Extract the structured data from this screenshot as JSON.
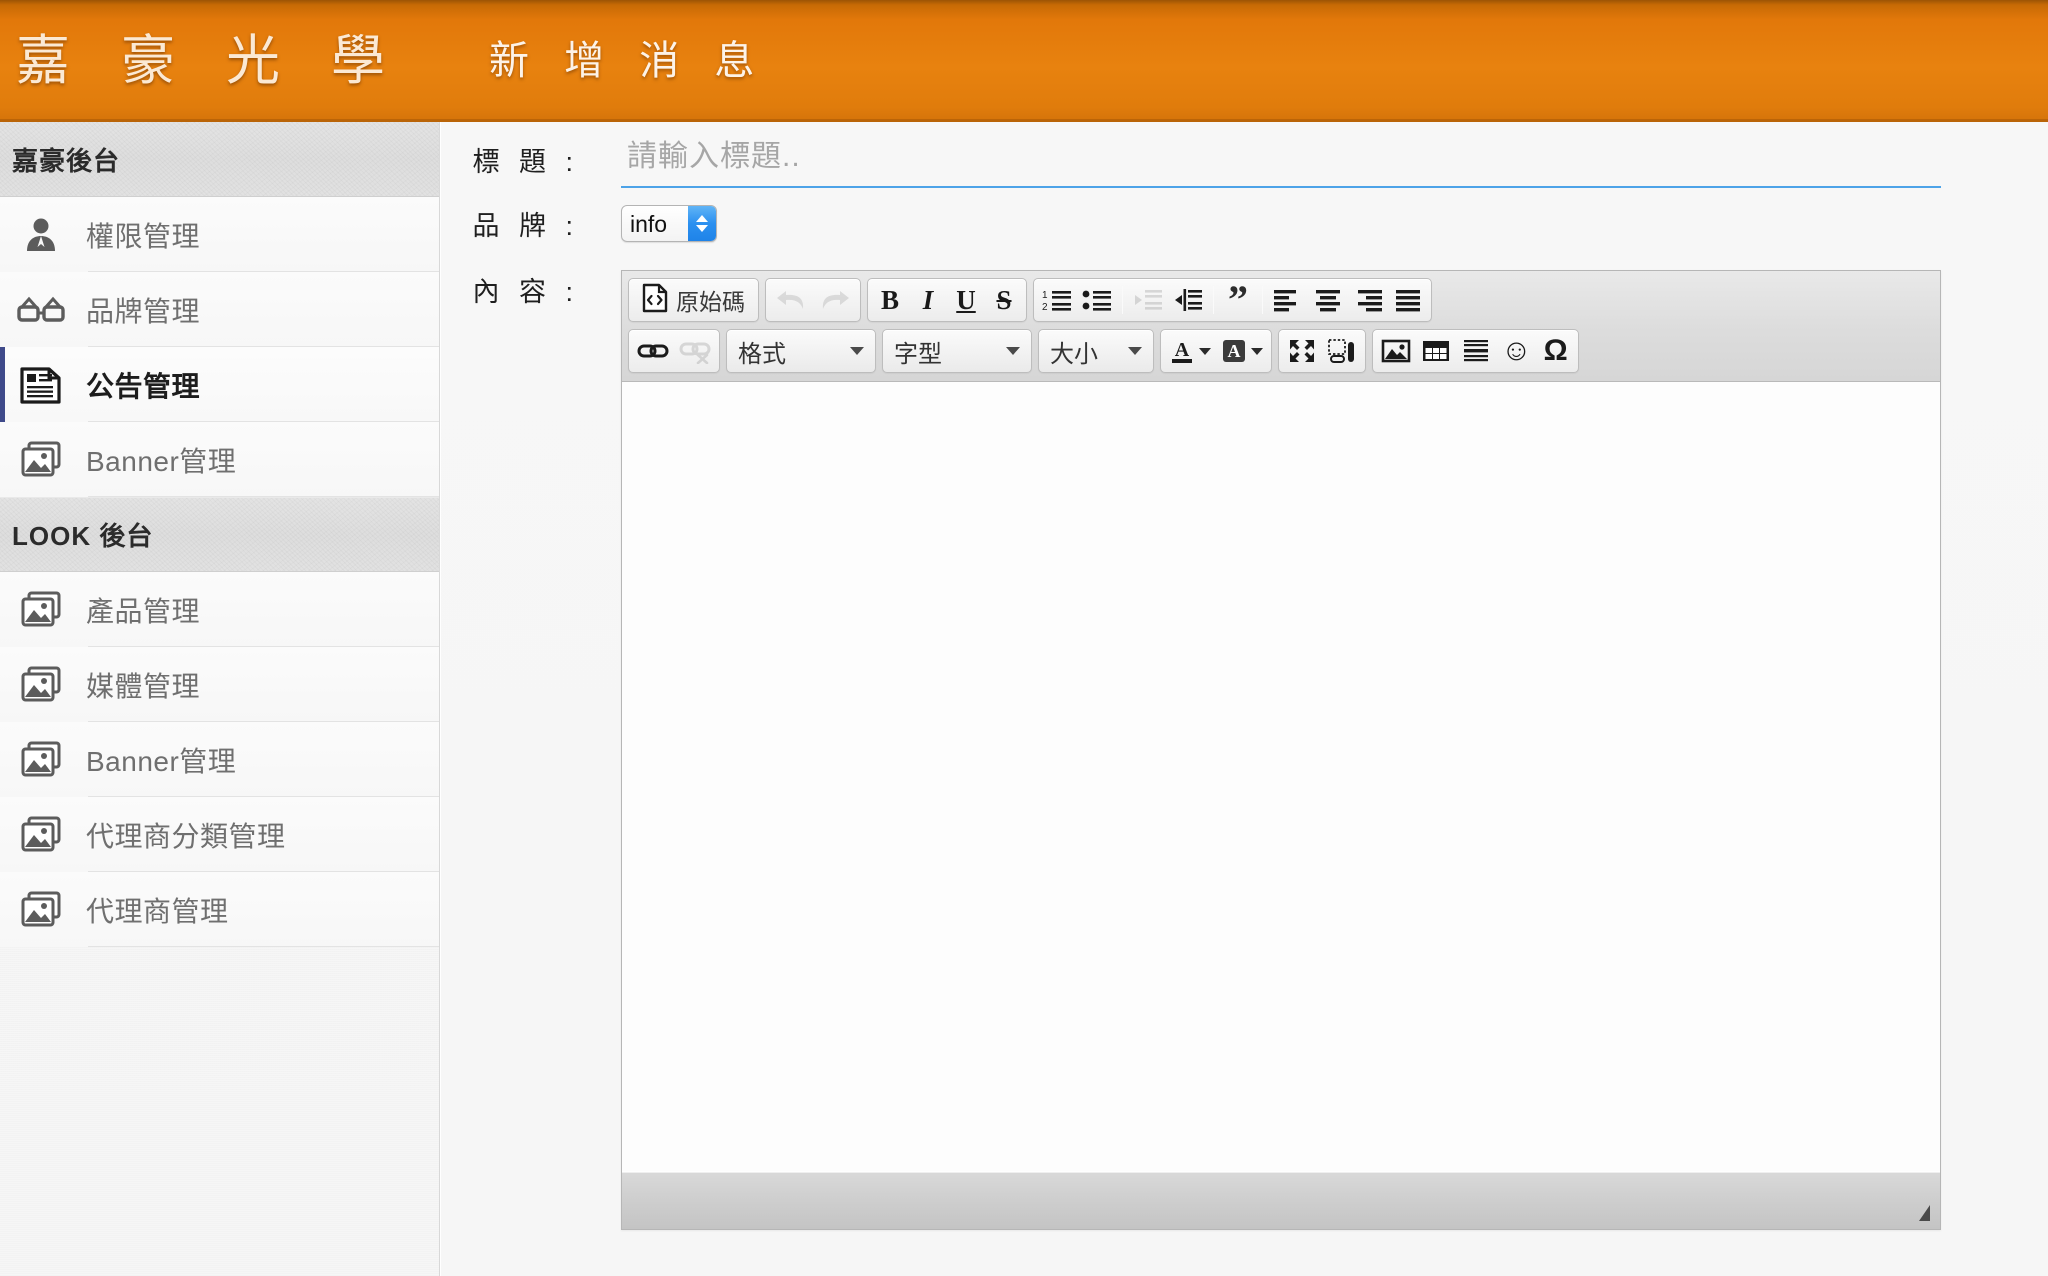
{
  "header": {
    "logo_text": "嘉 豪 光 學",
    "page_title": "新 增 消 息",
    "accent_color": "#e8820f"
  },
  "sidebar": {
    "sections": [
      {
        "title": "嘉豪後台",
        "items": [
          {
            "label": "權限管理",
            "icon": "user-icon",
            "active": false
          },
          {
            "label": "品牌管理",
            "icon": "glasses-icon",
            "active": false
          },
          {
            "label": "公告管理",
            "icon": "document-icon",
            "active": true
          },
          {
            "label": "Banner管理",
            "icon": "images-icon",
            "active": false
          }
        ]
      },
      {
        "title": "LOOK 後台",
        "items": [
          {
            "label": "產品管理",
            "icon": "images-icon",
            "active": false
          },
          {
            "label": "媒體管理",
            "icon": "images-icon",
            "active": false
          },
          {
            "label": "Banner管理",
            "icon": "images-icon",
            "active": false
          },
          {
            "label": "代理商分類管理",
            "icon": "images-icon",
            "active": false
          },
          {
            "label": "代理商管理",
            "icon": "images-icon",
            "active": false
          }
        ]
      }
    ],
    "active_indicator_color": "#3f4a8a"
  },
  "form": {
    "title_label": "標 題 :",
    "title_value": "",
    "title_placeholder": "請輸入標題..",
    "title_underline_color": "#4da3e8",
    "brand_label": "品 牌 :",
    "brand_selected": "info",
    "brand_options": [
      "info"
    ],
    "content_label": "內 容 :"
  },
  "editor": {
    "toolbar_row1": {
      "source_button": "原始碼",
      "undo": "undo-icon",
      "redo": "redo-icon",
      "bold": "B",
      "italic": "I",
      "underline": "U",
      "strike": "S",
      "numbered_list": "numbered-list-icon",
      "bulleted_list": "bulleted-list-icon",
      "outdent": "outdent-icon",
      "indent": "indent-icon",
      "blockquote": "”",
      "align_left": "align-left-icon",
      "align_center": "align-center-icon",
      "align_right": "align-right-icon",
      "align_justify": "align-justify-icon"
    },
    "toolbar_row2": {
      "link": "link-icon",
      "unlink": "unlink-icon",
      "format_label": "格式",
      "font_label": "字型",
      "size_label": "大小",
      "text_color": "A",
      "bg_color": "A",
      "maximize": "maximize-icon",
      "show_blocks": "show-blocks-icon",
      "image": "image-icon",
      "table": "table-icon",
      "horizontal_rule": "horizontal-rule-icon",
      "smiley": "☺",
      "special_char": "Ω"
    },
    "body_content": "",
    "status_text": ""
  }
}
